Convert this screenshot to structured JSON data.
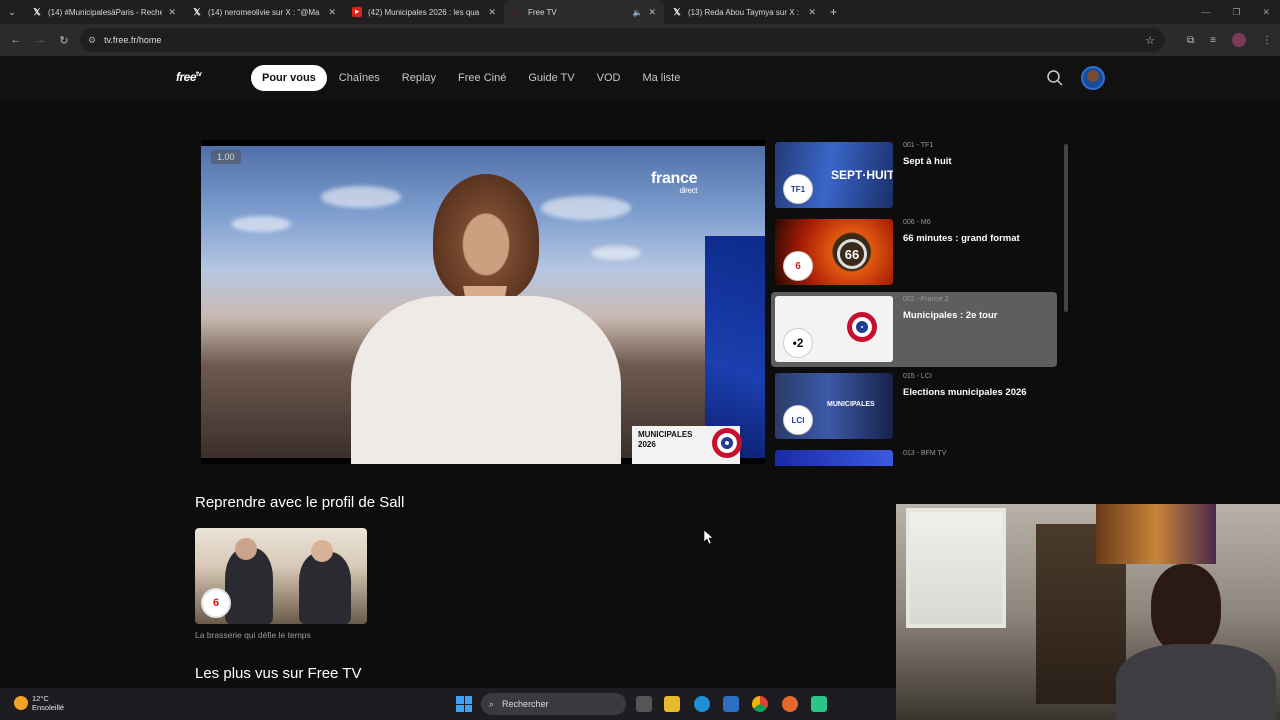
{
  "browser": {
    "tabs": [
      {
        "title": "(14) #MunicipalesàParis - Reche",
        "favicon": "x-icon"
      },
      {
        "title": "(14) neromeolivie sur X : \"@Ma",
        "favicon": "x-icon"
      },
      {
        "title": "(42) Municipales 2026 : les qua",
        "favicon": "youtube-icon"
      },
      {
        "title": "Free TV",
        "favicon": "freetv-icon",
        "active": true
      },
      {
        "title": "(13) Reda Abou Taymya sur X :",
        "favicon": "x-icon"
      }
    ],
    "url": "tv.free.fr/home"
  },
  "site": {
    "logo": "free",
    "logo_sup": "tv",
    "nav": [
      "Pour vous",
      "Chaînes",
      "Replay",
      "Free Ciné",
      "Guide TV",
      "VOD",
      "Ma liste"
    ],
    "nav_active": "Pour vous"
  },
  "player": {
    "speed": "1.00",
    "channel_badge": "france",
    "channel_badge_sub": "direct",
    "overlay_line1": "MUNICIPALES",
    "overlay_line2": "2026"
  },
  "channels": [
    {
      "meta": "001 - TF1",
      "name": "Sept à huit",
      "logo": "TF1"
    },
    {
      "meta": "006 - M6",
      "name": "66 minutes : grand format",
      "logo": "6"
    },
    {
      "meta": "002 - France 2",
      "name": "Municipales : 2e tour",
      "logo": "•2",
      "selected": true
    },
    {
      "meta": "015 - LCI",
      "name": "Elections municipales 2026",
      "logo": "LCI"
    },
    {
      "meta": "013 - BFM TV",
      "name": "",
      "logo": ""
    }
  ],
  "resume": {
    "heading": "Reprendre avec le profil de Sall",
    "item_title": "La brasserie qui défie le temps",
    "item_logo": "6"
  },
  "popular": {
    "heading": "Les plus vus sur Free TV"
  },
  "taskbar": {
    "temp": "12°C",
    "weather": "Ensoleillé",
    "search": "Rechercher"
  },
  "colors": {
    "accent_blue": "#2f6fd6",
    "france2_red": "#c8102e",
    "background": "#0d0d0d"
  }
}
